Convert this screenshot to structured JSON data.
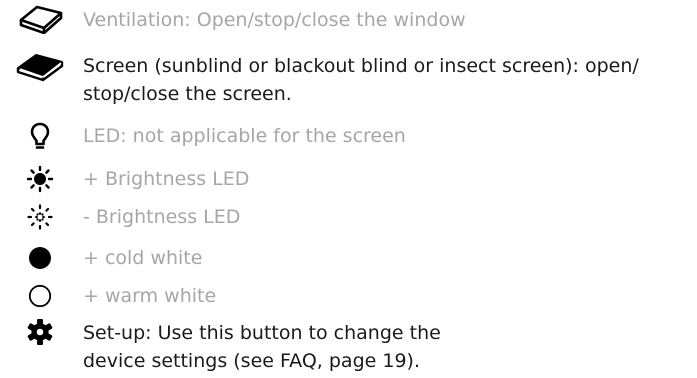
{
  "items": [
    {
      "icon": "window-outline-icon",
      "text": "Ventilation: Open/stop/close the window",
      "active": false
    },
    {
      "icon": "window-filled-icon",
      "text_line1": "Screen (sunblind or blackout blind or insect screen): open/",
      "text_line2": "stop/close the screen.",
      "active": true
    },
    {
      "icon": "lightbulb-icon",
      "text": "LED: not applicable for the screen",
      "active": false
    },
    {
      "icon": "brightness-up-icon",
      "text": "+ Brightness LED",
      "active": false
    },
    {
      "icon": "brightness-down-icon",
      "text": "- Brightness LED",
      "active": false
    },
    {
      "icon": "filled-circle-icon",
      "text": "+ cold white",
      "active": false
    },
    {
      "icon": "hollow-circle-icon",
      "text": "+ warm white",
      "active": false
    },
    {
      "icon": "gear-icon",
      "text_line1": "Set-up: Use this button to change the",
      "text_line2": "device settings (see FAQ, page 19).",
      "active": true
    }
  ],
  "colors": {
    "muted_text": "#a6a6a6",
    "dark_text": "#1a1a1a",
    "icon": "#000000"
  }
}
